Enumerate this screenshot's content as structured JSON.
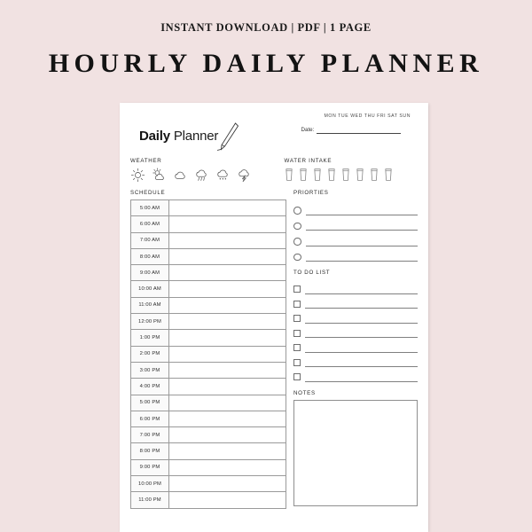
{
  "listing": {
    "instant_download": "INSTANT DOWNLOAD  | PDF | 1 PAGE",
    "title": "HOURLY DAILY PLANNER"
  },
  "planner": {
    "brand": {
      "word_bold": "Daily",
      "word_regular": "Planner",
      "pen_icon": "pen-icon"
    },
    "date": {
      "weekdays": "MON TUE WED THU FRI SAT SUN",
      "label": "Date:"
    },
    "weather": {
      "label": "WEATHER",
      "icons": [
        "sun-icon",
        "partly-cloudy-icon",
        "cloud-icon",
        "rain-icon",
        "snow-icon",
        "storm-icon"
      ]
    },
    "water_intake": {
      "label": "WATER INTAKE",
      "glass_count": 8,
      "glass_icon": "water-glass-icon"
    },
    "schedule": {
      "label": "SCHEDULE",
      "times": [
        "5:00 AM",
        "6:00 AM",
        "7:00 AM",
        "8:00 AM",
        "9:00 AM",
        "10:00 AM",
        "11:00 AM",
        "12:00 PM",
        "1:00 PM",
        "2:00 PM",
        "3:00 PM",
        "4:00 PM",
        "5:00 PM",
        "6:00 PM",
        "7:00 PM",
        "8:00 PM",
        "9:00 PM",
        "10:00 PM",
        "11:00 PM"
      ]
    },
    "priorities": {
      "label": "PRIORTIES",
      "row_count": 4
    },
    "todo": {
      "label": "TO DO LIST",
      "row_count": 7
    },
    "notes": {
      "label": "NOTES"
    }
  },
  "colors": {
    "background": "#f1e2e2",
    "paper": "#ffffff",
    "ink": "#131313",
    "rule": "#8f8f8f"
  }
}
